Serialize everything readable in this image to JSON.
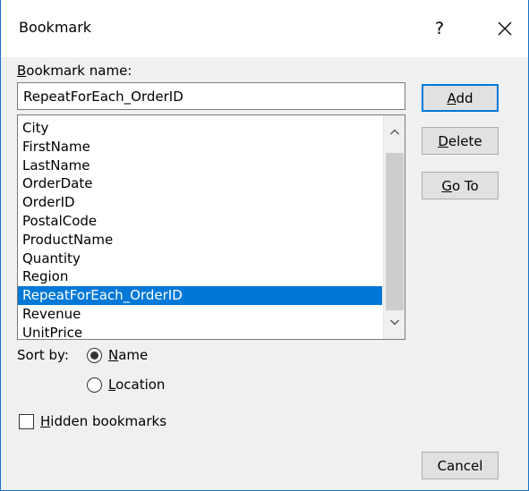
{
  "dialog": {
    "title": "Bookmark",
    "help_label": "?"
  },
  "bookmark_name": {
    "label": "Bookmark name:",
    "value": "RepeatForEach_OrderID"
  },
  "bookmarks": [
    {
      "label": "City"
    },
    {
      "label": "FirstName"
    },
    {
      "label": "LastName"
    },
    {
      "label": "OrderDate"
    },
    {
      "label": "OrderID"
    },
    {
      "label": "PostalCode"
    },
    {
      "label": "ProductName"
    },
    {
      "label": "Quantity"
    },
    {
      "label": "Region"
    },
    {
      "label": "RepeatForEach_OrderID",
      "selected": true
    },
    {
      "label": "Revenue"
    },
    {
      "label": "UnitPrice"
    }
  ],
  "buttons": {
    "add": "Add",
    "delete": "Delete",
    "goto": "Go To",
    "cancel": "Cancel"
  },
  "sort": {
    "label": "Sort by:",
    "name_option": "Name",
    "location_option": "Location",
    "selected": "name"
  },
  "hidden_bookmarks": {
    "label": "Hidden bookmarks",
    "checked": false
  },
  "colors": {
    "selection": "#0078d7",
    "window_border": "#1a73c4"
  }
}
